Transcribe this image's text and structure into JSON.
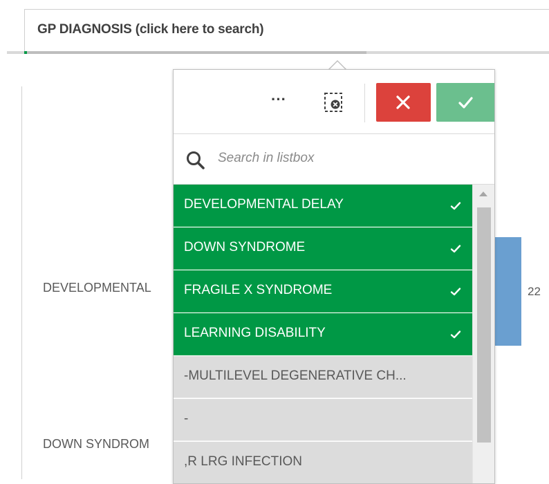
{
  "filter": {
    "title": "GP DIAGNOSIS (click here to search)"
  },
  "chart_behind": {
    "labels": [
      "DEVELOPMENTAL",
      "DOWN SYNDROM"
    ],
    "visible_value": "22",
    "bar_color": "#6a9fd0"
  },
  "popover": {
    "toolbar": {
      "more_label": "···",
      "more_icon": "ellipsis-icon",
      "clear_icon": "clear-selection-icon",
      "cancel_icon": "close-icon",
      "confirm_icon": "checkmark-icon",
      "cancel_color": "#dc423c",
      "confirm_color": "#6bbf8e"
    },
    "search": {
      "placeholder": "Search in listbox",
      "value": ""
    },
    "items": [
      {
        "label": "DEVELOPMENTAL DELAY",
        "state": "selected"
      },
      {
        "label": "DOWN SYNDROME",
        "state": "selected"
      },
      {
        "label": "FRAGILE X SYNDROME",
        "state": "selected"
      },
      {
        "label": "LEARNING DISABILITY",
        "state": "selected"
      },
      {
        "label": "-MULTILEVEL DEGENERATIVE CH...",
        "state": "excluded"
      },
      {
        "label": "-",
        "state": "excluded"
      },
      {
        "label": ",R LRG INFECTION",
        "state": "excluded"
      }
    ],
    "selected_color": "#009845",
    "excluded_color": "#dcdcdc"
  }
}
